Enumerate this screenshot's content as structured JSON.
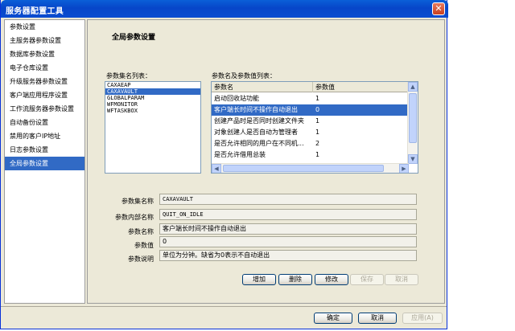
{
  "window": {
    "title": "服务器配置工具",
    "close_glyph": "✕"
  },
  "nav": {
    "items": [
      "参数设置",
      "主服务器参数设置",
      "数据库参数设置",
      "电子仓库设置",
      "升级服务器参数设置",
      "客户端应用程序设置",
      "工作流服务器参数设置",
      "自动备份设置",
      "禁用的客户IP地址",
      "日志参数设置",
      "全局参数设置"
    ],
    "selected_index": 10
  },
  "main": {
    "section_title": "全局参数设置",
    "param_set_list_label": "参数集名列表：",
    "param_value_list_label": "参数名及参数值列表：",
    "param_sets": [
      "CAXAEAP",
      "CAXAVAULT",
      "GLOBALPARAM",
      "WFMONITOR",
      "WFTASKBOX"
    ],
    "selected_param_set_index": 1,
    "table": {
      "headers": [
        "参数名",
        "参数值"
      ],
      "rows": [
        {
          "name": "启动回收站功能",
          "value": "1"
        },
        {
          "name": "客户端长时间不操作自动退出",
          "value": "0"
        },
        {
          "name": "创建产品时是否同时创建文件夹",
          "value": "1"
        },
        {
          "name": "对象创建人是否自动为管理者",
          "value": "1"
        },
        {
          "name": "是否允许相同的用户在不同机...",
          "value": "2"
        },
        {
          "name": "是否允许借用总装",
          "value": "1"
        }
      ],
      "selected_row_index": 1
    },
    "details": {
      "set_name_label": "参数集名称",
      "set_name_value": "CAXAVAULT",
      "internal_name_label": "参数内部名称",
      "internal_name_value": "QUIT_ON_IDLE",
      "param_name_label": "参数名称",
      "param_name_value": "客户端长时间不操作自动退出",
      "param_value_label": "参数值",
      "param_value_value": "0",
      "desc_label": "参数说明",
      "desc_value": "单位为分钟。缺省为0表示不自动退出"
    },
    "actions": {
      "add": "增加",
      "delete": "删除",
      "modify": "修改",
      "save": "保存",
      "cancel": "取消"
    }
  },
  "footer": {
    "ok": "确定",
    "cancel": "取消",
    "apply": "应用(A)"
  },
  "colors": {
    "title_bar": "#0a5fd8",
    "selection": "#316ac5",
    "dialog_bg": "#ece9d8"
  }
}
